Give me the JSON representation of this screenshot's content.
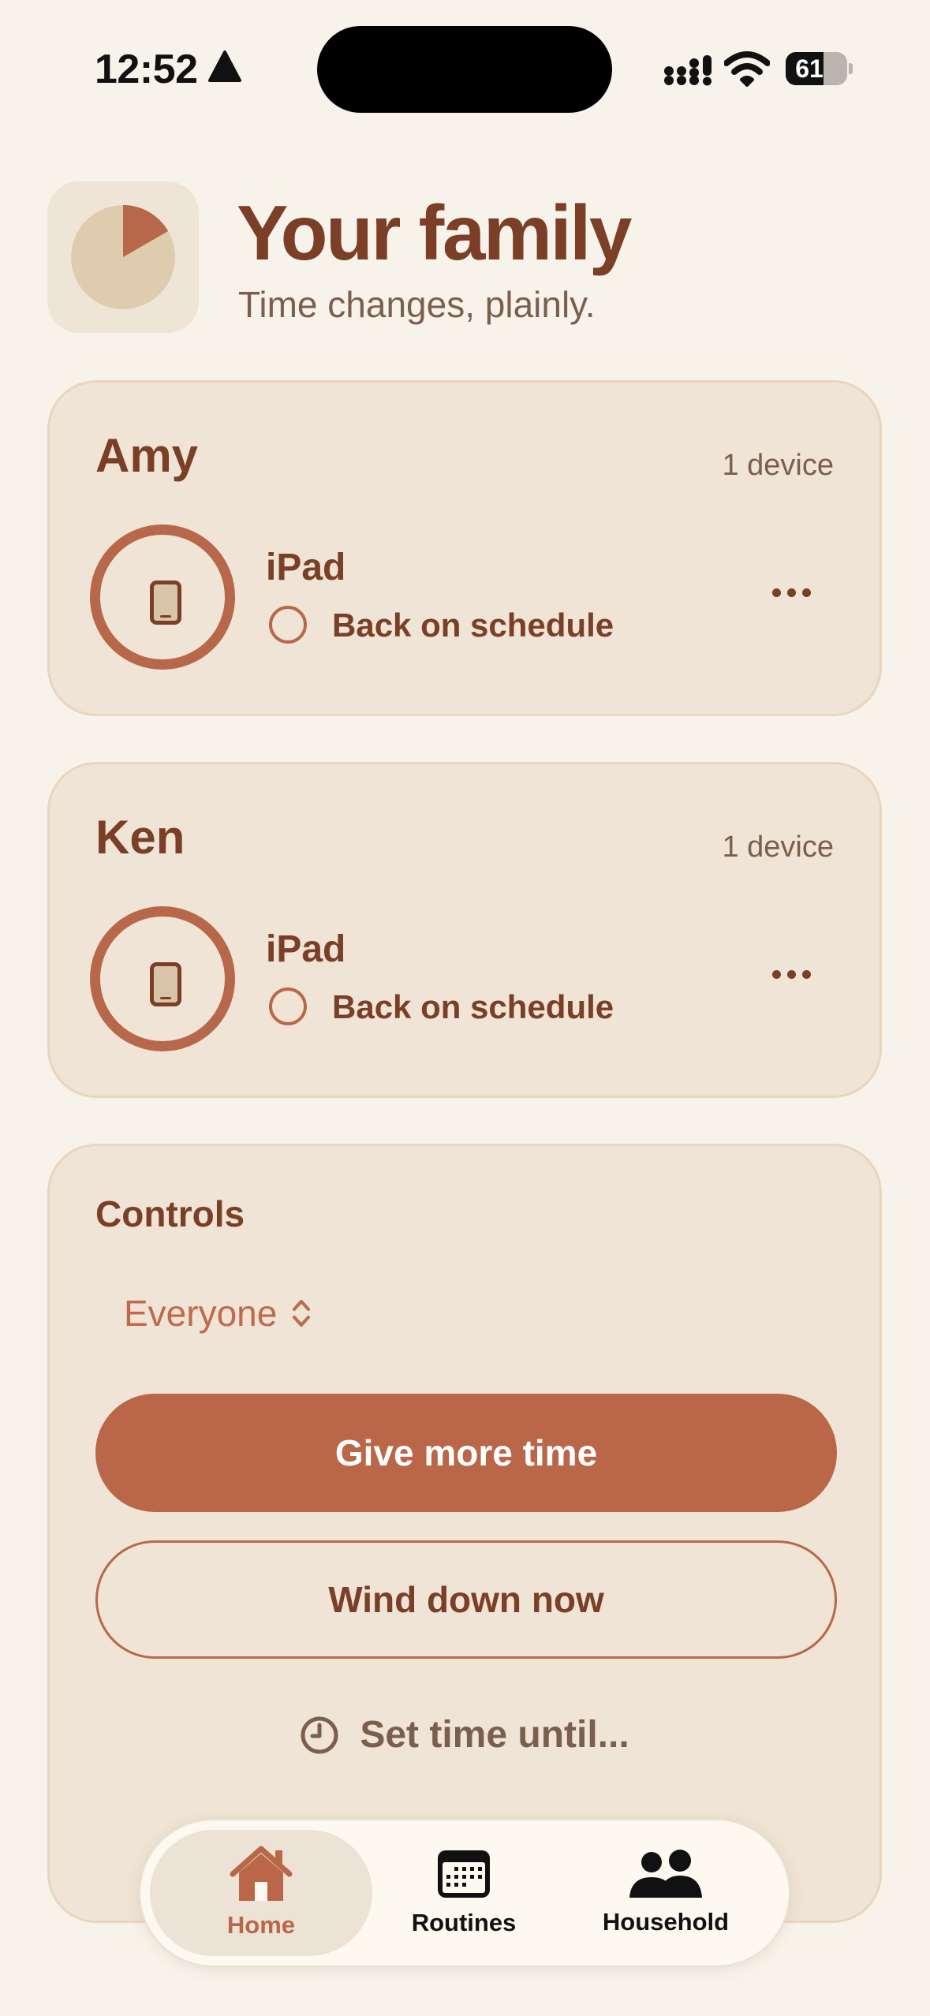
{
  "status_bar": {
    "time": "12:52",
    "battery": "61",
    "battery_level": 0.61
  },
  "header": {
    "title": "Your family",
    "subtitle": "Time changes, plainly."
  },
  "people": [
    {
      "name": "Amy",
      "device_count": "1 device",
      "device": {
        "name": "iPad",
        "status": "Back on schedule"
      }
    },
    {
      "name": "Ken",
      "device_count": "1 device",
      "device": {
        "name": "iPad",
        "status": "Back on schedule"
      }
    }
  ],
  "controls": {
    "title": "Controls",
    "scope": "Everyone",
    "primary_action": "Give more time",
    "secondary_action": "Wind down now",
    "time_until": "Set time until..."
  },
  "tab_bar": {
    "tabs": [
      {
        "label": "Home",
        "icon": "house-icon",
        "active": true
      },
      {
        "label": "Routines",
        "icon": "calendar-icon",
        "active": false
      },
      {
        "label": "Household",
        "icon": "people-icon",
        "active": false
      }
    ]
  },
  "colors": {
    "background": "#f8f3ea",
    "card": "#efe4d5",
    "accent": "#b96748",
    "heading": "#7a3f26"
  }
}
